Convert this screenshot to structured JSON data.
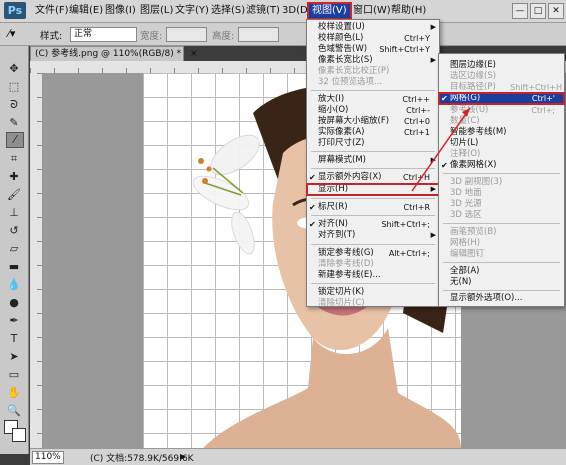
{
  "app": {
    "logo": "Ps"
  },
  "menubar": {
    "items": [
      "文件(F)",
      "编辑(E)",
      "图像(I)",
      "图层(L)",
      "文字(Y)",
      "选择(S)",
      "滤镜(T)",
      "3D(D)",
      "视图(V)",
      "窗口(W)",
      "帮助(H)"
    ],
    "window_buttons": [
      "—",
      "□",
      "✕"
    ]
  },
  "options_bar": {
    "style_label": "样式:",
    "style_value": "正常",
    "width_label": "宽度:",
    "height_label": "高度:"
  },
  "document_tab": {
    "label": "(C) 参考线.png @ 110%(RGB/8) *",
    "close": "×"
  },
  "view_menu": {
    "items": [
      {
        "label": "校样设置(U)",
        "shortcut": "",
        "submenu": true,
        "disabled": false
      },
      {
        "label": "校样颜色(L)",
        "shortcut": "Ctrl+Y",
        "disabled": false
      },
      {
        "label": "色域警告(W)",
        "shortcut": "Shift+Ctrl+Y",
        "disabled": false
      },
      {
        "label": "像素长宽比(S)",
        "shortcut": "",
        "submenu": true,
        "disabled": false
      },
      {
        "label": "像素长宽比校正(P)",
        "shortcut": "",
        "disabled": true
      },
      {
        "label": "32 位预览选项...",
        "shortcut": "",
        "disabled": true
      },
      {
        "label": "放大(I)",
        "shortcut": "Ctrl++",
        "disabled": false
      },
      {
        "label": "缩小(O)",
        "shortcut": "Ctrl+-",
        "disabled": false
      },
      {
        "label": "按屏幕大小缩放(F)",
        "shortcut": "Ctrl+0",
        "disabled": false
      },
      {
        "label": "实际像素(A)",
        "shortcut": "Ctrl+1",
        "disabled": false
      },
      {
        "label": "打印尺寸(Z)",
        "shortcut": "",
        "disabled": false
      },
      {
        "label": "屏幕模式(M)",
        "shortcut": "",
        "submenu": true,
        "disabled": false
      },
      {
        "label": "显示额外内容(X)",
        "shortcut": "Ctrl+H",
        "checked": true,
        "disabled": false
      },
      {
        "label": "显示(H)",
        "shortcut": "",
        "submenu": true,
        "disabled": false
      },
      {
        "label": "标尺(R)",
        "shortcut": "Ctrl+R",
        "checked": true,
        "disabled": false
      },
      {
        "label": "对齐(N)",
        "shortcut": "Shift+Ctrl+;",
        "checked": true,
        "disabled": false
      },
      {
        "label": "对齐到(T)",
        "shortcut": "",
        "submenu": true,
        "disabled": false
      },
      {
        "label": "锁定参考线(G)",
        "shortcut": "Alt+Ctrl+;",
        "disabled": false
      },
      {
        "label": "清除参考线(D)",
        "shortcut": "",
        "disabled": true
      },
      {
        "label": "新建参考线(E)...",
        "shortcut": "",
        "disabled": false
      },
      {
        "label": "锁定切片(K)",
        "shortcut": "",
        "disabled": false
      },
      {
        "label": "清除切片(C)",
        "shortcut": "",
        "disabled": true
      }
    ]
  },
  "show_submenu": {
    "items": [
      {
        "label": "图层边缘(E)",
        "shortcut": "",
        "disabled": false
      },
      {
        "label": "选区边缘(S)",
        "shortcut": "",
        "disabled": true
      },
      {
        "label": "目标路径(P)",
        "shortcut": "Shift+Ctrl+H",
        "disabled": true
      },
      {
        "label": "网格(G)",
        "shortcut": "Ctrl+'",
        "checked": true,
        "disabled": false
      },
      {
        "label": "参考线(U)",
        "shortcut": "Ctrl+;",
        "disabled": true
      },
      {
        "label": "数量(C)",
        "shortcut": "",
        "disabled": true
      },
      {
        "label": "智能参考线(M)",
        "shortcut": "",
        "disabled": false
      },
      {
        "label": "切片(L)",
        "shortcut": "",
        "disabled": false
      },
      {
        "label": "注释(O)",
        "shortcut": "",
        "disabled": true
      },
      {
        "label": "像素网格(X)",
        "shortcut": "",
        "checked": true,
        "disabled": false
      },
      {
        "label": "3D 副视图(3)",
        "shortcut": "",
        "disabled": true
      },
      {
        "label": "3D 地面",
        "shortcut": "",
        "disabled": true
      },
      {
        "label": "3D 光源",
        "shortcut": "",
        "disabled": true
      },
      {
        "label": "3D 选区",
        "shortcut": "",
        "disabled": true
      },
      {
        "label": "画笔预览(B)",
        "shortcut": "",
        "disabled": true
      },
      {
        "label": "网格(H)",
        "shortcut": "",
        "disabled": true
      },
      {
        "label": "编辑图钉",
        "shortcut": "",
        "disabled": true
      },
      {
        "label": "全部(A)",
        "shortcut": "",
        "disabled": false
      },
      {
        "label": "无(N)",
        "shortcut": "",
        "disabled": false
      },
      {
        "label": "显示额外选项(O)...",
        "shortcut": "",
        "disabled": false
      }
    ]
  },
  "status_bar": {
    "zoom": "110%",
    "doc_info": "(C) 文档:578.9K/569.6K"
  },
  "colors": {
    "menu_highlight": "#1c3f9f",
    "annotation_red": "#d2232a"
  }
}
